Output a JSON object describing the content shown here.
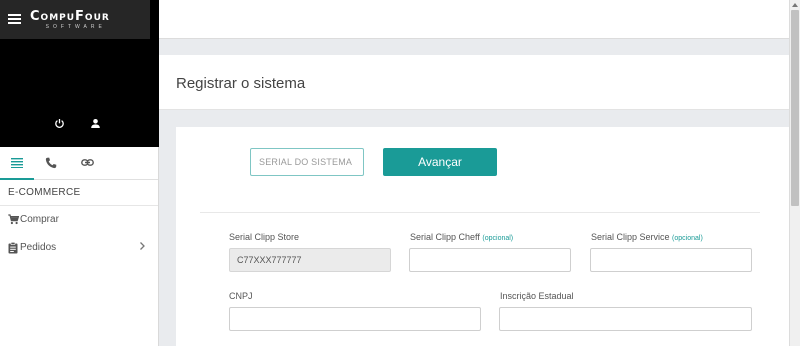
{
  "brand": {
    "name": "CompuFour",
    "tagline": "SOFTWARE"
  },
  "sidebar": {
    "tabs": [
      {
        "icon": "list-icon",
        "active": true
      },
      {
        "icon": "phone-icon",
        "active": false
      },
      {
        "icon": "link-icon",
        "active": false
      }
    ],
    "section_title": "E-COMMERCE",
    "items": [
      {
        "label": "Comprar",
        "icon": "cart-icon"
      },
      {
        "label": "Pedidos",
        "icon": "clipboard-icon"
      }
    ]
  },
  "page": {
    "title": "Registrar o sistema"
  },
  "serial": {
    "placeholder": "SERIAL DO SISTEMA",
    "button_label": "Avançar"
  },
  "form": {
    "store": {
      "label": "Serial Clipp Store",
      "value": "C77XXX777777"
    },
    "cheff": {
      "label": "Serial Clipp Cheff",
      "optional": "(opcional)",
      "value": ""
    },
    "service": {
      "label": "Serial Clipp Service",
      "optional": "(opcional)",
      "value": ""
    },
    "cnpj": {
      "label": "CNPJ",
      "value": ""
    },
    "ie": {
      "label": "Inscrição Estadual",
      "value": ""
    }
  },
  "colors": {
    "accent": "#1a9b97",
    "header_bg": "#000000",
    "page_bg": "#e9ebee"
  }
}
